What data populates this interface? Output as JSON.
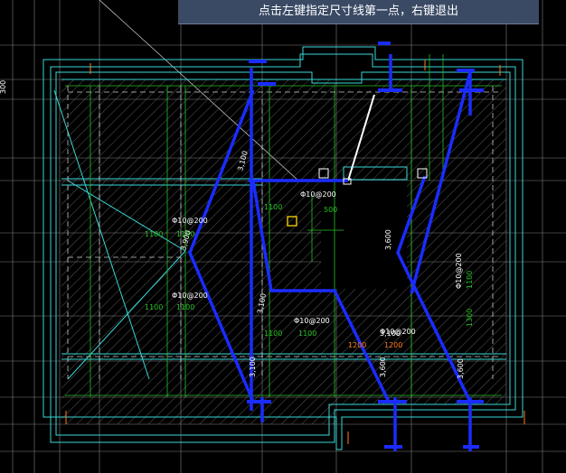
{
  "prompt": {
    "text": "点击左键指定尺寸线第一点，右键退出"
  },
  "side_label": "300",
  "colors": {
    "background": "#000000",
    "outline_cyan": "#39d8d8",
    "rebar_blue": "#1a2cff",
    "hatch": "#8a8a8a",
    "text_white": "#ffffff",
    "dim_green": "#25c225",
    "dim_orange": "#ff7a1a",
    "cursor_yellow": "#ffd700"
  },
  "rebar_labels": [
    {
      "id": "a",
      "text": "Φ10@200"
    },
    {
      "id": "b",
      "text": "Φ10@200"
    },
    {
      "id": "c",
      "text": "Φ10@200"
    },
    {
      "id": "d",
      "text": "Φ10@200"
    },
    {
      "id": "e",
      "text": "Φ10@200"
    },
    {
      "id": "f",
      "text": "Φ10@200"
    }
  ],
  "dimensions": [
    {
      "id": "d1",
      "text": "1100"
    },
    {
      "id": "d2",
      "text": "1100"
    },
    {
      "id": "d3",
      "text": "1100"
    },
    {
      "id": "d4",
      "text": "1100"
    },
    {
      "id": "d5",
      "text": "1100"
    },
    {
      "id": "d6",
      "text": "500"
    },
    {
      "id": "d7",
      "text": "1100"
    },
    {
      "id": "d8",
      "text": "1100"
    },
    {
      "id": "d9",
      "text": "1200"
    },
    {
      "id": "d10",
      "text": "1200"
    },
    {
      "id": "d11",
      "text": "1100"
    },
    {
      "id": "d12",
      "text": "1300"
    }
  ],
  "bar_lengths": [
    {
      "id": "b1",
      "text": "3,900"
    },
    {
      "id": "b2",
      "text": "3,100"
    },
    {
      "id": "b3",
      "text": "3,100"
    },
    {
      "id": "b4",
      "text": "3,100"
    },
    {
      "id": "b5",
      "text": "3,600"
    },
    {
      "id": "b6",
      "text": "3,600"
    },
    {
      "id": "b7",
      "text": "3,600"
    },
    {
      "id": "b8",
      "text": "3,100"
    }
  ]
}
